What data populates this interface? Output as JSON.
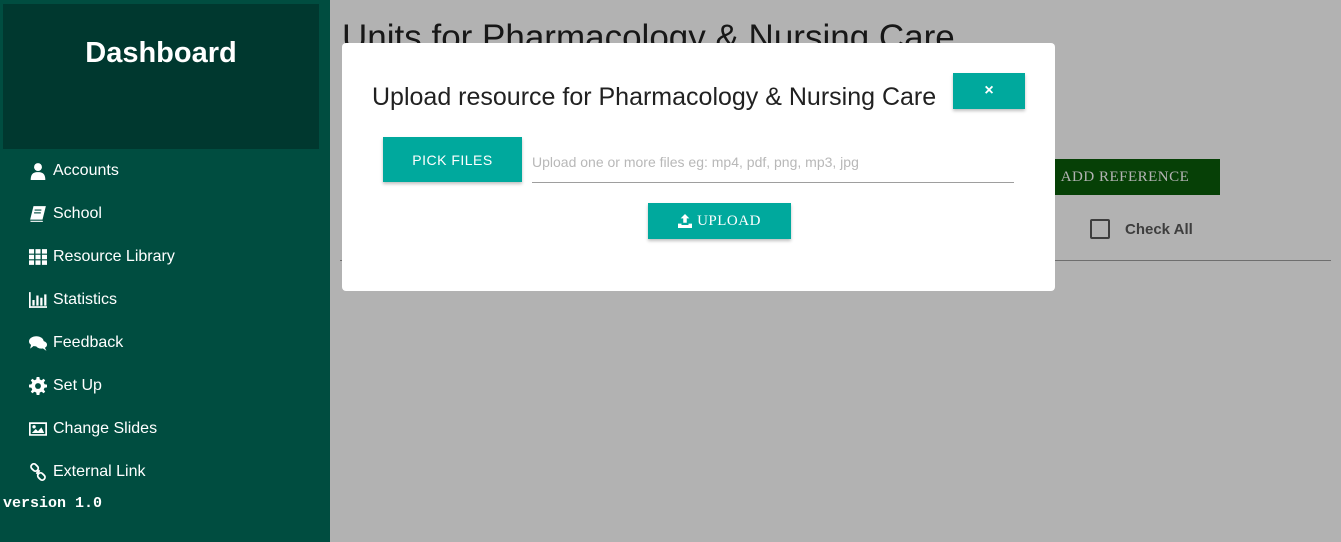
{
  "sidebar": {
    "title": "Dashboard",
    "items": [
      {
        "label": "Accounts",
        "icon": "user-icon"
      },
      {
        "label": "School",
        "icon": "book-icon"
      },
      {
        "label": "Resource Library",
        "icon": "grid-icon"
      },
      {
        "label": "Statistics",
        "icon": "bar-chart-icon"
      },
      {
        "label": "Feedback",
        "icon": "comments-icon"
      },
      {
        "label": "Set Up",
        "icon": "gear-icon"
      },
      {
        "label": "Change Slides",
        "icon": "image-icon"
      },
      {
        "label": "External Link",
        "icon": "link-icon"
      }
    ],
    "version": "version 1.0"
  },
  "main": {
    "title": "Units for Pharmacology & Nursing Care",
    "add_reference_label": "ADD REFERENCE",
    "check_all_label": "Check All"
  },
  "modal": {
    "title": "Upload resource for Pharmacology & Nursing Care",
    "close_label": "×",
    "pick_files_label": "PICK FILES",
    "file_input_placeholder": "Upload one or more files eg: mp4, pdf, png, mp3, jpg",
    "upload_label": "UPLOAD"
  },
  "colors": {
    "sidebar_bg": "#004d40",
    "brand_bg": "#00382f",
    "accent": "#00a99d",
    "add_reference_bg": "#0a5c0a"
  }
}
